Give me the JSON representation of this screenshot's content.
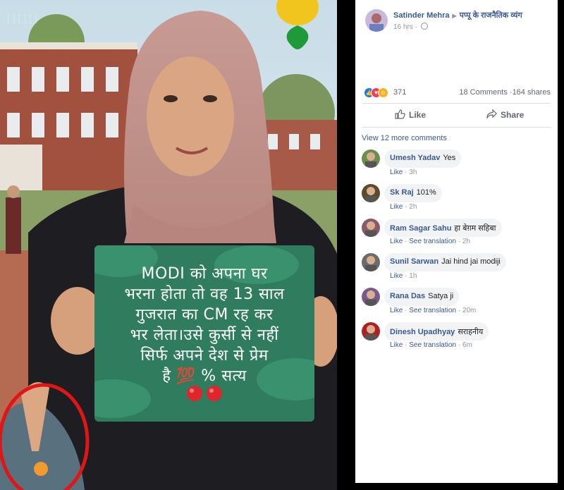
{
  "post": {
    "author": "Satinder Mehra",
    "group_arrow": "▶",
    "group": "पप्पू के राजनैतिक व्यंग",
    "time": "16 hrs",
    "time_sep": "·",
    "reaction_count": "371",
    "comments_count": "18 Comments",
    "shares_count": "164 shares",
    "stats_sep": "·",
    "like_label": "Like",
    "share_label": "Share",
    "view_more": "View 12 more comments"
  },
  "sign": {
    "lines": [
      "MODI को अपना घर",
      "भरना होता तो वह 13 साल",
      "गुजरात का CM रह कर",
      "भर लेता।उसे कुर्सी से नहीं",
      "सिर्फ अपने देश से प्रेम",
      "है 💯 % सत्य"
    ]
  },
  "comments": [
    {
      "name": "Umesh Yadav",
      "text": "Yes",
      "like": "Like",
      "translation": "",
      "time": "3h",
      "color": "#6b8e4e"
    },
    {
      "name": "Sk Raj",
      "text": "101%",
      "like": "Like",
      "translation": "",
      "time": "2h",
      "color": "#5b4a2e"
    },
    {
      "name": "Ram Sagar Sahu",
      "text": "हा बेग़म सहिबा",
      "like": "Like",
      "translation": "See translation",
      "time": "2h",
      "color": "#8a5a6a"
    },
    {
      "name": "Sunil Sarwan",
      "text": "Jai hind jai modiji",
      "like": "Like",
      "translation": "",
      "time": "1h",
      "color": "#6c6c6c"
    },
    {
      "name": "Rana Das",
      "text": "Satya ji",
      "like": "Like",
      "translation": "See translation",
      "time": "20m",
      "color": "#7a5a8a"
    },
    {
      "name": "Dinesh Upadhyay",
      "text": "सराहनीय",
      "like": "Like",
      "translation": "See translation",
      "time": "6m",
      "color": "#b02020"
    }
  ],
  "separators": {
    "dot": "·"
  },
  "colors": {
    "link": "#385898",
    "sign_green": "#2f7c5e",
    "like_blue": "#1877f2",
    "love_red": "#f33e58",
    "wow_yellow": "#f7b125"
  }
}
